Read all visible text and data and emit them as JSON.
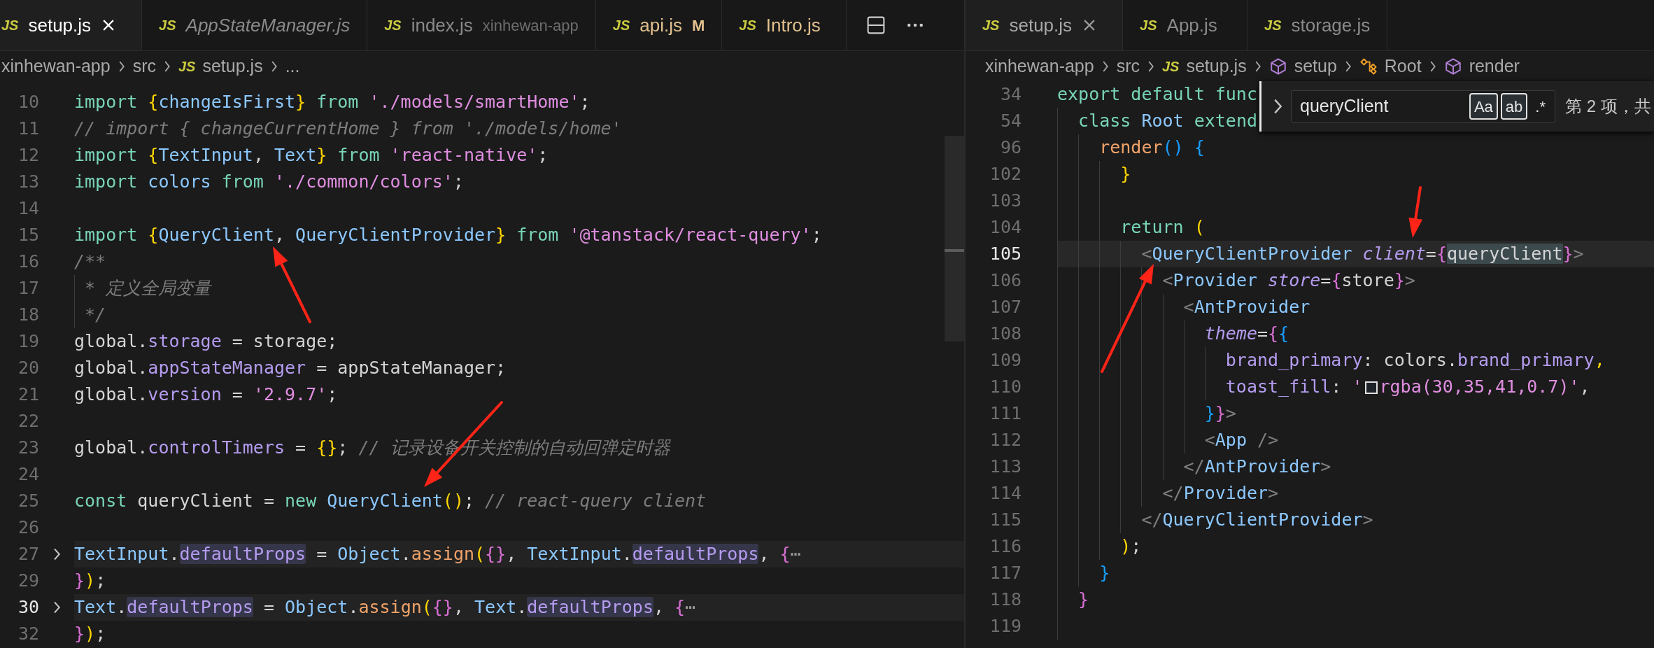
{
  "editor_groups": [
    {
      "tabs": [
        {
          "file_icon": "JS",
          "label": "setup.js",
          "selected": true,
          "preview": false,
          "modified": false
        },
        {
          "file_icon": "JS",
          "label": "AppStateManager.js",
          "selected": false,
          "preview": true,
          "modified": false
        },
        {
          "file_icon": "JS",
          "label": "index.js",
          "description": "xinhewan-app",
          "selected": false,
          "preview": false,
          "modified": false
        },
        {
          "file_icon": "JS",
          "label": "api.js",
          "badge": "M",
          "selected": false,
          "preview": false,
          "modified": true
        },
        {
          "file_icon": "JS",
          "label": "Intro.js",
          "selected": false,
          "preview": false,
          "modified": true
        }
      ],
      "breadcrumbs": [
        {
          "kind": "folder",
          "label": "xinhewan-app"
        },
        {
          "kind": "folder",
          "label": "src"
        },
        {
          "kind": "file",
          "file_icon": "JS",
          "label": "setup.js"
        },
        {
          "kind": "folder",
          "label": "..."
        }
      ],
      "lines": [
        {
          "number": "10",
          "folded": false,
          "current": false,
          "tokens": [
            {
              "kind": "kw",
              "text": "import "
            },
            {
              "kind": "b1",
              "text": "{"
            },
            {
              "kind": "type",
              "text": "changeIsFirst"
            },
            {
              "kind": "b1",
              "text": "} "
            },
            {
              "kind": "kw",
              "text": "from "
            },
            {
              "kind": "str",
              "text": "'./models/smartHome'"
            },
            {
              "kind": "plain",
              "text": ";"
            }
          ]
        },
        {
          "number": "11",
          "folded": false,
          "current": false,
          "tokens": [
            {
              "kind": "cmt",
              "text": "// import { changeCurrentHome } from './models/home'"
            }
          ]
        },
        {
          "number": "12",
          "folded": false,
          "current": false,
          "tokens": [
            {
              "kind": "kw",
              "text": "import "
            },
            {
              "kind": "b1",
              "text": "{"
            },
            {
              "kind": "type",
              "text": "TextInput"
            },
            {
              "kind": "plain",
              "text": ", "
            },
            {
              "kind": "type",
              "text": "Text"
            },
            {
              "kind": "b1",
              "text": "} "
            },
            {
              "kind": "kw",
              "text": "from "
            },
            {
              "kind": "str",
              "text": "'react-native'"
            },
            {
              "kind": "plain",
              "text": ";"
            }
          ]
        },
        {
          "number": "13",
          "folded": false,
          "current": false,
          "tokens": [
            {
              "kind": "kw",
              "text": "import "
            },
            {
              "kind": "type",
              "text": "colors "
            },
            {
              "kind": "kw",
              "text": "from "
            },
            {
              "kind": "str",
              "text": "'./common/colors'"
            },
            {
              "kind": "plain",
              "text": ";"
            }
          ]
        },
        {
          "number": "14",
          "folded": false,
          "current": false
        },
        {
          "number": "15",
          "folded": false,
          "current": false,
          "tokens": [
            {
              "kind": "kw",
              "text": "import "
            },
            {
              "kind": "b1",
              "text": "{"
            },
            {
              "kind": "type",
              "text": "QueryClient"
            },
            {
              "kind": "plain",
              "text": ", "
            },
            {
              "kind": "type",
              "text": "QueryClientProvider"
            },
            {
              "kind": "b1",
              "text": "} "
            },
            {
              "kind": "kw",
              "text": "from "
            },
            {
              "kind": "str",
              "text": "'@tanstack/react-query'"
            },
            {
              "kind": "plain",
              "text": ";"
            }
          ]
        },
        {
          "number": "16",
          "folded": false,
          "current": false,
          "tokens": [
            {
              "kind": "cmt",
              "text": "/**"
            }
          ]
        },
        {
          "number": "17",
          "folded": false,
          "current": false,
          "tokens": [
            {
              "kind": "cmt",
              "text": " * 定义全局变量"
            }
          ]
        },
        {
          "number": "18",
          "folded": false,
          "current": false,
          "tokens": [
            {
              "kind": "cmt",
              "text": " */"
            }
          ]
        },
        {
          "number": "19",
          "folded": false,
          "current": false,
          "tokens": [
            {
              "kind": "plain",
              "text": "global."
            },
            {
              "kind": "prop",
              "text": "storage"
            },
            {
              "kind": "plain",
              "text": " = storage;"
            }
          ]
        },
        {
          "number": "20",
          "folded": false,
          "current": false,
          "tokens": [
            {
              "kind": "plain",
              "text": "global."
            },
            {
              "kind": "prop",
              "text": "appStateManager"
            },
            {
              "kind": "plain",
              "text": " = appStateManager;"
            }
          ]
        },
        {
          "number": "21",
          "folded": false,
          "current": false,
          "tokens": [
            {
              "kind": "plain",
              "text": "global."
            },
            {
              "kind": "prop",
              "text": "version"
            },
            {
              "kind": "plain",
              "text": " = "
            },
            {
              "kind": "str",
              "text": "'2.9.7'"
            },
            {
              "kind": "plain",
              "text": ";"
            }
          ]
        },
        {
          "number": "22",
          "folded": false,
          "current": false
        },
        {
          "number": "23",
          "folded": false,
          "current": false,
          "tokens": [
            {
              "kind": "plain",
              "text": "global."
            },
            {
              "kind": "prop",
              "text": "controlTimers"
            },
            {
              "kind": "plain",
              "text": " = "
            },
            {
              "kind": "b1",
              "text": "{}"
            },
            {
              "kind": "plain",
              "text": "; "
            },
            {
              "kind": "cmt",
              "text": "// 记录设备开关控制的自动回弹定时器"
            }
          ]
        },
        {
          "number": "24",
          "folded": false,
          "current": false
        },
        {
          "number": "25",
          "folded": false,
          "current": false,
          "tokens": [
            {
              "kind": "kw",
              "text": "const "
            },
            {
              "kind": "plain",
              "text": "queryClient = "
            },
            {
              "kind": "kw",
              "text": "new "
            },
            {
              "kind": "type",
              "text": "QueryClient"
            },
            {
              "kind": "b1",
              "text": "()"
            },
            {
              "kind": "plain",
              "text": "; "
            },
            {
              "kind": "cmt",
              "text": "// react-query client"
            }
          ]
        },
        {
          "number": "26",
          "folded": false,
          "current": false
        },
        {
          "number": "27",
          "folded": true,
          "current": false,
          "tokens": [
            {
              "kind": "type",
              "text": "TextInput"
            },
            {
              "kind": "plain",
              "text": "."
            },
            {
              "kind": "prop",
              "text": "defaultProps",
              "highlighted": true
            },
            {
              "kind": "plain",
              "text": " = "
            },
            {
              "kind": "type",
              "text": "Object"
            },
            {
              "kind": "plain",
              "text": "."
            },
            {
              "kind": "fn",
              "text": "assign"
            },
            {
              "kind": "b1",
              "text": "("
            },
            {
              "kind": "b2",
              "text": "{}"
            },
            {
              "kind": "plain",
              "text": ", "
            },
            {
              "kind": "type",
              "text": "TextInput"
            },
            {
              "kind": "plain",
              "text": "."
            },
            {
              "kind": "prop",
              "text": "defaultProps",
              "highlighted": true
            },
            {
              "kind": "plain",
              "text": ", "
            },
            {
              "kind": "b2",
              "text": "{"
            },
            {
              "kind": "ell",
              "text": "⋯"
            }
          ]
        },
        {
          "number": "29",
          "folded": false,
          "current": false,
          "tokens": [
            {
              "kind": "b2",
              "text": "}"
            },
            {
              "kind": "b1",
              "text": ")"
            },
            {
              "kind": "plain",
              "text": ";"
            }
          ]
        },
        {
          "number": "30",
          "folded": true,
          "current": true,
          "tokens": [
            {
              "kind": "type",
              "text": "Text"
            },
            {
              "kind": "plain",
              "text": "."
            },
            {
              "kind": "prop",
              "text": "defaultProps",
              "highlighted": true
            },
            {
              "kind": "plain",
              "text": " = "
            },
            {
              "kind": "type",
              "text": "Object"
            },
            {
              "kind": "plain",
              "text": "."
            },
            {
              "kind": "fn",
              "text": "assign"
            },
            {
              "kind": "b1",
              "text": "("
            },
            {
              "kind": "b2",
              "text": "{}"
            },
            {
              "kind": "plain",
              "text": ", "
            },
            {
              "kind": "type",
              "text": "Text"
            },
            {
              "kind": "plain",
              "text": "."
            },
            {
              "kind": "prop",
              "text": "defaultProps",
              "highlighted": true
            },
            {
              "kind": "plain",
              "text": ", "
            },
            {
              "kind": "b2",
              "text": "{"
            },
            {
              "kind": "ell",
              "text": "⋯"
            }
          ]
        },
        {
          "number": "32",
          "folded": false,
          "current": false,
          "tokens": [
            {
              "kind": "b2",
              "text": "}"
            },
            {
              "kind": "b1",
              "text": ")"
            },
            {
              "kind": "plain",
              "text": ";"
            }
          ]
        }
      ]
    },
    {
      "tabs": [
        {
          "file_icon": "JS",
          "label": "setup.js",
          "selected": true,
          "preview": false,
          "modified": false
        },
        {
          "file_icon": "JS",
          "label": "App.js",
          "selected": false,
          "preview": false,
          "modified": false
        },
        {
          "file_icon": "JS",
          "label": "storage.js",
          "selected": false,
          "preview": false,
          "modified": false
        }
      ],
      "breadcrumbs": [
        {
          "kind": "folder",
          "label": "xinhewan-app"
        },
        {
          "kind": "folder",
          "label": "src"
        },
        {
          "kind": "file",
          "file_icon": "JS",
          "label": "setup.js"
        },
        {
          "kind": "method",
          "label": "setup"
        },
        {
          "kind": "class",
          "label": "Root"
        },
        {
          "kind": "method",
          "label": "render"
        }
      ],
      "find_widget": {
        "query": "queryClient",
        "options": [
          {
            "label": "Aa",
            "selected": true
          },
          {
            "label": "ab",
            "selected": true
          },
          {
            "label": ".*",
            "selected": false
          }
        ],
        "result": "第 2 项，共"
      },
      "lines": [
        {
          "number": "34",
          "folded": false,
          "current": false,
          "tokens": [
            {
              "kind": "kw",
              "text": "export default func"
            }
          ]
        },
        {
          "number": "54",
          "folded": false,
          "current": false,
          "tokens": [
            {
              "kind": "kw",
              "text": "  class "
            },
            {
              "kind": "type",
              "text": "Root "
            },
            {
              "kind": "kw",
              "text": "extend"
            }
          ]
        },
        {
          "number": "96",
          "folded": false,
          "current": false,
          "tokens": [
            {
              "kind": "fn",
              "text": "    render"
            },
            {
              "kind": "b3",
              "text": "() {"
            }
          ]
        },
        {
          "number": "102",
          "folded": false,
          "current": false,
          "tokens": [
            {
              "kind": "b1",
              "text": "      }"
            }
          ]
        },
        {
          "number": "103",
          "folded": false,
          "current": false
        },
        {
          "number": "104",
          "folded": false,
          "current": false,
          "tokens": [
            {
              "kind": "kw",
              "text": "      return "
            },
            {
              "kind": "b1",
              "text": "("
            }
          ]
        },
        {
          "number": "105",
          "folded": false,
          "current": true,
          "tokens": [
            {
              "kind": "punct",
              "text": "        <"
            },
            {
              "kind": "type",
              "text": "QueryClientProvider "
            },
            {
              "kind": "attr",
              "text": "client"
            },
            {
              "kind": "plain",
              "text": "="
            },
            {
              "kind": "b2",
              "text": "{"
            },
            {
              "kind": "plain",
              "text": "queryClient",
              "highlighted": true
            },
            {
              "kind": "b2",
              "text": "}"
            },
            {
              "kind": "punct",
              "text": ">"
            }
          ]
        },
        {
          "number": "106",
          "folded": false,
          "current": false,
          "tokens": [
            {
              "kind": "punct",
              "text": "          <"
            },
            {
              "kind": "type",
              "text": "Provider "
            },
            {
              "kind": "attr",
              "text": "store"
            },
            {
              "kind": "plain",
              "text": "="
            },
            {
              "kind": "b2",
              "text": "{"
            },
            {
              "kind": "plain",
              "text": "store"
            },
            {
              "kind": "b2",
              "text": "}"
            },
            {
              "kind": "punct",
              "text": ">"
            }
          ]
        },
        {
          "number": "107",
          "folded": false,
          "current": false,
          "tokens": [
            {
              "kind": "punct",
              "text": "            <"
            },
            {
              "kind": "type",
              "text": "AntProvider"
            }
          ]
        },
        {
          "number": "108",
          "folded": false,
          "current": false,
          "tokens": [
            {
              "kind": "attr",
              "text": "              theme"
            },
            {
              "kind": "plain",
              "text": "="
            },
            {
              "kind": "b2",
              "text": "{"
            },
            {
              "kind": "b3",
              "text": "{"
            }
          ]
        },
        {
          "number": "109",
          "folded": false,
          "current": false,
          "tokens": [
            {
              "kind": "prop",
              "text": "                brand_primary"
            },
            {
              "kind": "plain",
              "text": ": colors."
            },
            {
              "kind": "prop",
              "text": "brand_primary"
            },
            {
              "kind": "b1",
              "text": ","
            }
          ]
        },
        {
          "number": "110",
          "folded": false,
          "current": false,
          "tokens": [
            {
              "kind": "prop",
              "text": "                toast_fill"
            },
            {
              "kind": "plain",
              "text": ": "
            },
            {
              "kind": "str",
              "text": "'"
            },
            {
              "kind": "str",
              "text": "rgba(30,35,41,0.7)'",
              "color": "#1e2329"
            },
            {
              "kind": "plain",
              "text": ","
            }
          ]
        },
        {
          "number": "111",
          "folded": false,
          "current": false,
          "tokens": [
            {
              "kind": "b3",
              "text": "              }"
            },
            {
              "kind": "b2",
              "text": "}"
            },
            {
              "kind": "punct",
              "text": ">"
            }
          ]
        },
        {
          "number": "112",
          "folded": false,
          "current": false,
          "tokens": [
            {
              "kind": "punct",
              "text": "              <"
            },
            {
              "kind": "type",
              "text": "App "
            },
            {
              "kind": "punct",
              "text": "/>"
            }
          ]
        },
        {
          "number": "113",
          "folded": false,
          "current": false,
          "tokens": [
            {
              "kind": "punct",
              "text": "            </"
            },
            {
              "kind": "type",
              "text": "AntProvider"
            },
            {
              "kind": "punct",
              "text": ">"
            }
          ]
        },
        {
          "number": "114",
          "folded": false,
          "current": false,
          "tokens": [
            {
              "kind": "punct",
              "text": "          </"
            },
            {
              "kind": "type",
              "text": "Provider"
            },
            {
              "kind": "punct",
              "text": ">"
            }
          ]
        },
        {
          "number": "115",
          "folded": false,
          "current": false,
          "tokens": [
            {
              "kind": "punct",
              "text": "        </"
            },
            {
              "kind": "type",
              "text": "QueryClientProvider"
            },
            {
              "kind": "punct",
              "text": ">"
            }
          ]
        },
        {
          "number": "116",
          "folded": false,
          "current": false,
          "tokens": [
            {
              "kind": "b1",
              "text": "      )"
            },
            {
              "kind": "plain",
              "text": ";"
            }
          ]
        },
        {
          "number": "117",
          "folded": false,
          "current": false,
          "tokens": [
            {
              "kind": "b3",
              "text": "    }"
            }
          ]
        },
        {
          "number": "118",
          "folded": false,
          "current": false,
          "tokens": [
            {
              "kind": "b2",
              "text": "  }"
            }
          ]
        },
        {
          "number": "119",
          "folded": false,
          "current": false
        }
      ]
    }
  ]
}
